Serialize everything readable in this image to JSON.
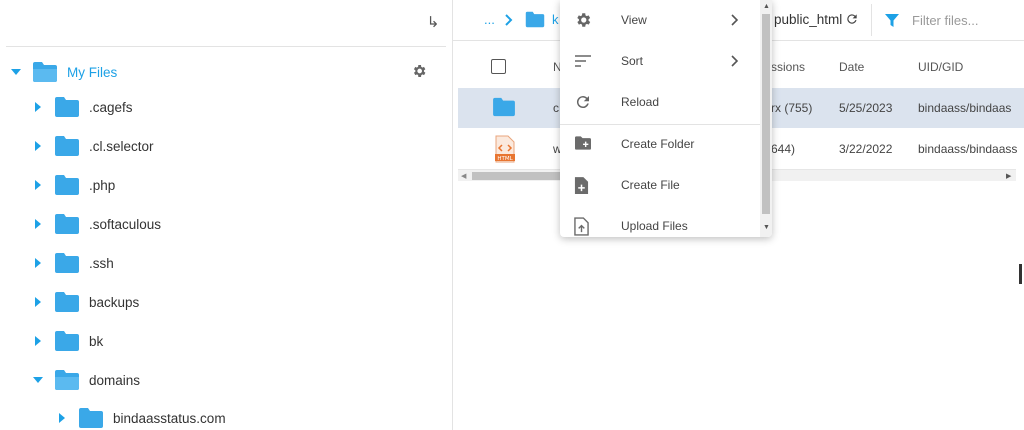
{
  "tree": {
    "root": {
      "label": "My Files"
    },
    "items": [
      {
        "label": ".cagefs"
      },
      {
        "label": ".cl.selector"
      },
      {
        "label": ".php"
      },
      {
        "label": ".softaculous"
      },
      {
        "label": ".ssh"
      },
      {
        "label": "backups"
      },
      {
        "label": "bk"
      },
      {
        "label": "domains"
      },
      {
        "label": "bindaasstatus.com"
      }
    ]
  },
  "breadcrumb": {
    "dots": "...",
    "partial": "k",
    "current": "public_html"
  },
  "filter": {
    "placeholder": "Filter files..."
  },
  "table": {
    "headers": {
      "name": "N",
      "permissions": "ssions",
      "date": "Date",
      "uidgid": "UID/GID"
    },
    "rows": [
      {
        "name": "c",
        "permissions": "rx (755)",
        "date": "5/25/2023",
        "uidgid": "bindaass/bindaas"
      },
      {
        "name": "w",
        "permissions": "644)",
        "date": "3/22/2022",
        "uidgid": "bindaass/bindaass",
        "icon_text": "HTML"
      }
    ]
  },
  "context_menu": {
    "items": [
      {
        "label": "View"
      },
      {
        "label": "Sort"
      },
      {
        "label": "Reload"
      },
      {
        "label": "Create Folder"
      },
      {
        "label": "Create File"
      },
      {
        "label": "Upload Files"
      }
    ]
  },
  "colors": {
    "accent": "#1da1e6",
    "folder": "#3aa8e8",
    "selected_row": "#dbe3ee"
  }
}
